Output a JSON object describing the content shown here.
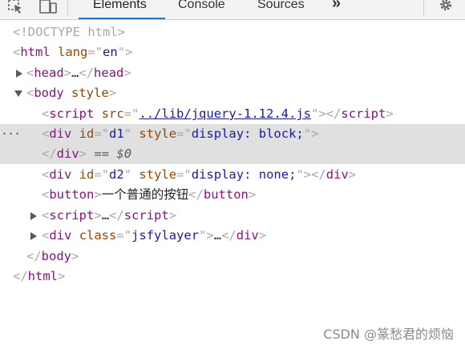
{
  "toolbar": {
    "tabs": [
      "Elements",
      "Console",
      "Sources"
    ],
    "active_tab": "Elements",
    "more_label": "»",
    "accent_color": "#1a73e8"
  },
  "tree": {
    "doctype": "<!DOCTYPE html>",
    "html_open": {
      "tag": "html",
      "attr": "lang",
      "value": "en"
    },
    "head": {
      "tag": "head",
      "ellipsis": "…"
    },
    "body_open": {
      "tag": "body",
      "attr": "style"
    },
    "script1": {
      "tag": "script",
      "attr": "src",
      "value": "../lib/jquery-1.12.4.js"
    },
    "div1": {
      "tag": "div",
      "id_attr": "id",
      "id_value": "d1",
      "style_attr": "style",
      "style_value": "display: block;"
    },
    "div1_close": {
      "tag": "div",
      "ref": "$0",
      "eqeq": "=="
    },
    "div2": {
      "tag": "div",
      "id_attr": "id",
      "id_value": "d2",
      "style_attr": "style",
      "style_value": "display: none;"
    },
    "button": {
      "tag": "button",
      "text": "一个普通的按钮"
    },
    "script2": {
      "tag": "script",
      "ellipsis": "…"
    },
    "div3": {
      "tag": "div",
      "attr": "class",
      "value": "jsfylayer",
      "ellipsis": "…"
    },
    "body_close": {
      "tag": "body"
    },
    "html_close": {
      "tag": "html"
    },
    "selected_dots": "···"
  },
  "watermark": "CSDN @篆愁君的烦恼"
}
